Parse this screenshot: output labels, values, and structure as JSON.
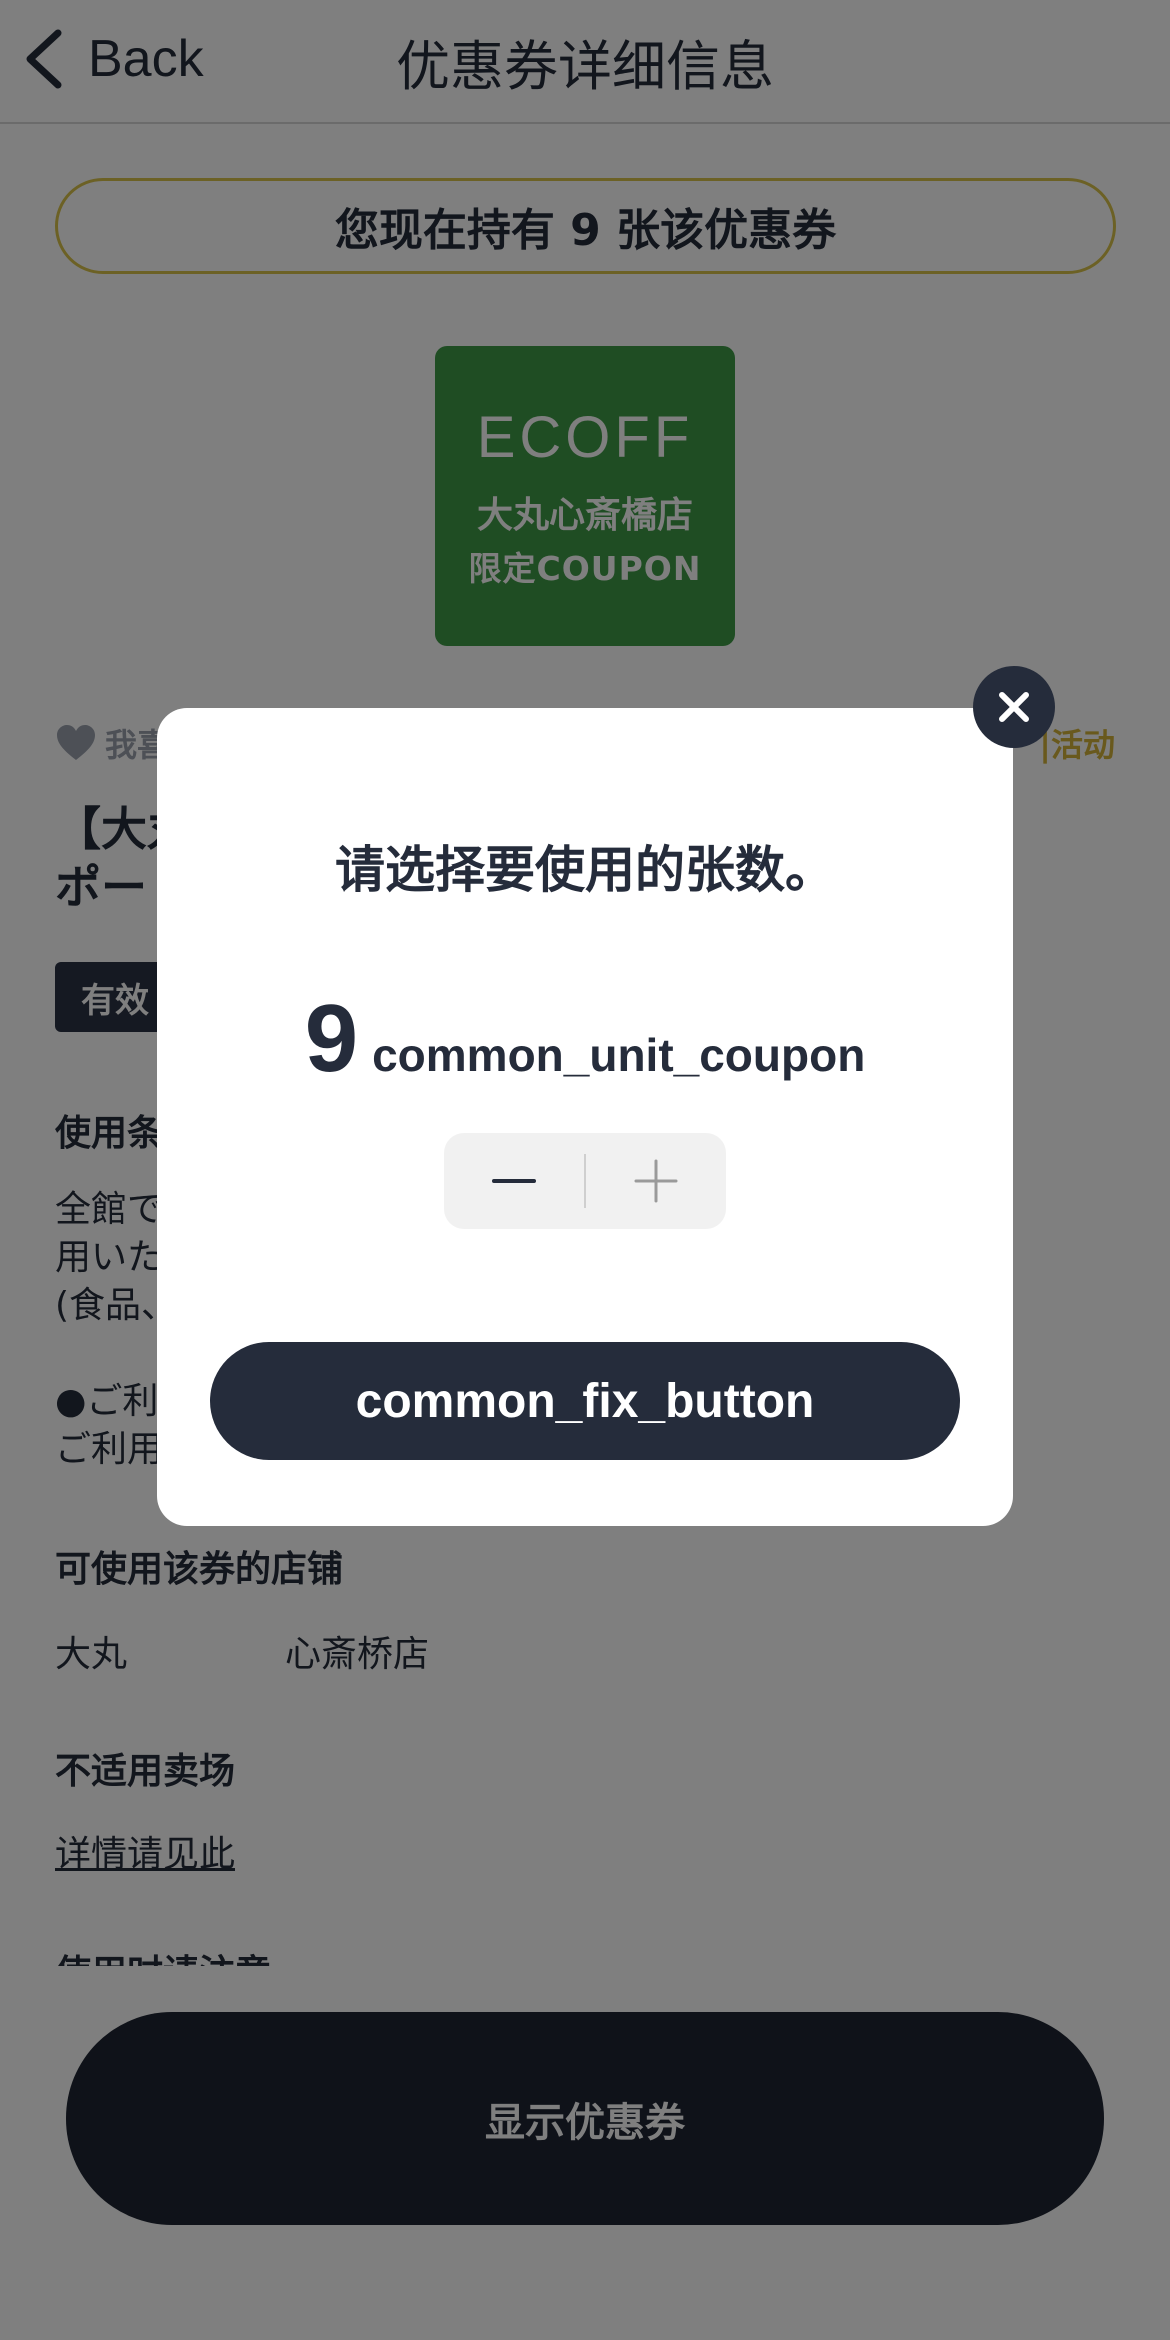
{
  "header": {
    "back_label": "Back",
    "title": "优惠券详细信息"
  },
  "holding_banner": "您现在持有 9 张该优惠券",
  "coupon_image": {
    "brand": "ECOFF",
    "line1": "大丸心斎橋店",
    "line2": "限定COUPON",
    "background_color": "#3f9a47"
  },
  "favorite": {
    "label": "我喜"
  },
  "event_link": "|活动",
  "coupon_title": "【大丸　　　　　　　　　　　　　　　　　　　　　　　ー\nポー",
  "validity": "有效",
  "sections": {
    "usage_conditions_heading": "使用条",
    "usage_text": "全館で　　　　　　　　　　　　　　　　　　　　　　　利\n用いた\n(食品、　　　　　　　　　　　　　　　　　　　　　　外)",
    "usage_note": "●ご利\nご利用",
    "stores_heading": "可使用该券的店铺",
    "store_name": "大丸",
    "store_branch": "心斎桥店",
    "excluded_heading": "不适用卖场",
    "details_link": "详情请见此",
    "notes_heading": "使用时请注意"
  },
  "show_coupon_button": "显示优惠券",
  "modal": {
    "title": "请选择要使用的张数。",
    "count": "9",
    "unit": "common_unit_coupon",
    "confirm_button": "common_fix_button"
  },
  "icons": {
    "back": "chevron-left-icon",
    "close": "close-icon",
    "minus": "minus-icon",
    "plus": "plus-icon",
    "heart": "heart-icon"
  },
  "colors": {
    "primary_dark": "#252c3b",
    "accent_gold": "#d9c24a",
    "coupon_green": "#3f9a47"
  }
}
